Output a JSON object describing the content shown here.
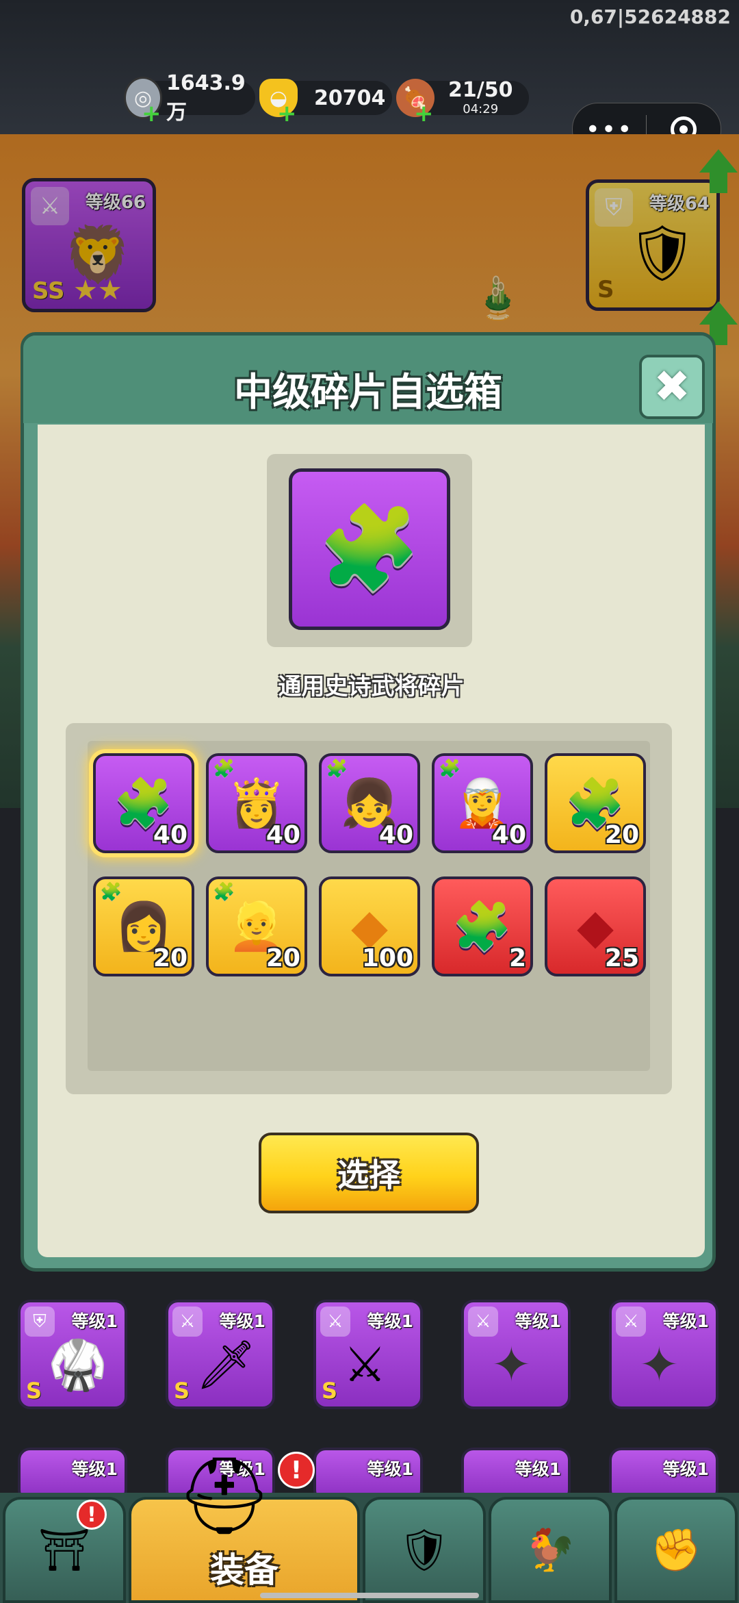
{
  "status": {
    "debug_text": "0,67|52624882"
  },
  "resources": [
    {
      "icon": "silver-coin-icon",
      "value": "1643.9万"
    },
    {
      "icon": "gold-ingot-icon",
      "value": "20704"
    },
    {
      "icon": "meat-icon",
      "value": "21/50",
      "timer": "04:29"
    }
  ],
  "heroes": {
    "left": {
      "level": "等级66",
      "grade": "SS"
    },
    "right": {
      "level": "等级64",
      "grade": "S"
    }
  },
  "dialog": {
    "title": "中级碎片自选箱",
    "preview_name": "通用史诗武将碎片",
    "select_label": "选择",
    "items": [
      {
        "name": "generic-epic-fragment",
        "color": "purple",
        "count": "40",
        "selected": true,
        "icon": "puzzle-icon"
      },
      {
        "name": "hero-fragment-1",
        "color": "purple",
        "count": "40",
        "icon": "hero-portrait-icon"
      },
      {
        "name": "hero-fragment-2",
        "color": "purple",
        "count": "40",
        "icon": "hero-portrait-icon"
      },
      {
        "name": "hero-fragment-3",
        "color": "purple",
        "count": "40",
        "icon": "hero-portrait-icon"
      },
      {
        "name": "generic-legend-fragment",
        "color": "gold",
        "count": "20",
        "icon": "puzzle-icon"
      },
      {
        "name": "hero-fragment-4",
        "color": "gold",
        "count": "20",
        "icon": "hero-portrait-icon"
      },
      {
        "name": "hero-fragment-5",
        "color": "gold",
        "count": "20",
        "icon": "hero-portrait-icon"
      },
      {
        "name": "gold-crystal",
        "color": "gold",
        "count": "100",
        "icon": "crystal-icon"
      },
      {
        "name": "generic-red-fragment",
        "color": "red",
        "count": "2",
        "icon": "puzzle-icon"
      },
      {
        "name": "red-crystal",
        "color": "red",
        "count": "25",
        "icon": "crystal-icon"
      }
    ]
  },
  "equipment_row": [
    {
      "level": "等级1",
      "grade": "S",
      "icon": "armor-icon"
    },
    {
      "level": "等级1",
      "grade": "S",
      "icon": "saber-icon"
    },
    {
      "level": "等级1",
      "grade": "S",
      "icon": "crossed-swords-icon"
    },
    {
      "level": "等级1",
      "grade": "",
      "icon": "shuriken-icon"
    },
    {
      "level": "等级1",
      "grade": "",
      "icon": "shuriken-icon"
    }
  ],
  "equipment_row2": [
    {
      "level": "等级1"
    },
    {
      "level": "等级1"
    },
    {
      "level": "等级1"
    },
    {
      "level": "等级1"
    },
    {
      "level": "等级1"
    }
  ],
  "nav": {
    "active_label": "装备",
    "tabs": [
      "gate-icon",
      "helmet-icon",
      "shield-swords-icon",
      "hero-icon",
      "fist-upgrade-icon"
    ]
  },
  "colors": {
    "purple": "#b54ae8",
    "gold": "#f7c22a",
    "red": "#e0383a",
    "dialog_green": "#5b9a85"
  }
}
